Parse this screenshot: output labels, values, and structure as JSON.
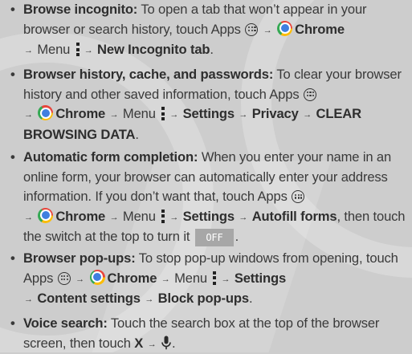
{
  "bullet_glyph": "•",
  "arrow_glyph": "→",
  "icons": {
    "apps": "apps-icon",
    "chrome": "chrome-icon",
    "menu": "menu-icon",
    "microphone": "microphone-icon"
  },
  "colors": {
    "background": "#cdcdcd",
    "text": "#3a3a3a",
    "switch_bg": "#a7a7a7",
    "switch_text": "#ffffff"
  },
  "items": [
    {
      "heading": "Browse incognito:",
      "text1": "To open a tab that won’t appear in your browser or search history, touch Apps",
      "chrome": "Chrome",
      "menu": "Menu",
      "step1": "New Incognito tab",
      "tail": "."
    },
    {
      "heading": "Browser history, cache, and passwords:",
      "text1": "To clear your browser history and other saved information, touch Apps",
      "chrome": "Chrome",
      "menu": "Menu",
      "step1": "Settings",
      "step2": "Privacy",
      "step3": "CLEAR BROWSING DATA",
      "tail": "."
    },
    {
      "heading": "Automatic form completion:",
      "text1": "When you enter your name in an online form, your browser can automatically enter your address information. If you don’t want that, touch Apps",
      "chrome": "Chrome",
      "menu": "Menu",
      "step1": "Settings",
      "step2": "Autofill forms",
      "text2": ", then touch the switch at the top to turn it",
      "switch_label": "OFF",
      "tail": "."
    },
    {
      "heading": "Browser pop-ups:",
      "text1": "To stop pop-up windows from opening, touch Apps",
      "chrome": "Chrome",
      "menu": "Menu",
      "step1": "Settings",
      "step2": "Content settings",
      "step3": "Block pop-ups",
      "tail": "."
    },
    {
      "heading": "Voice search:",
      "text1": "Touch the search box at the top of the browser screen, then touch",
      "key": "X",
      "tail": "."
    }
  ]
}
